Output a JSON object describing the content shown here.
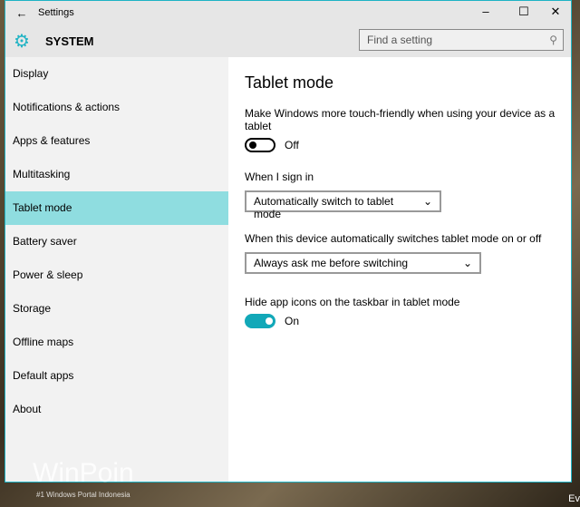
{
  "window": {
    "title": "Settings",
    "section": "SYSTEM"
  },
  "search": {
    "placeholder": "Find a setting"
  },
  "sidebar": {
    "items": [
      {
        "label": "Display"
      },
      {
        "label": "Notifications & actions"
      },
      {
        "label": "Apps & features"
      },
      {
        "label": "Multitasking"
      },
      {
        "label": "Tablet mode",
        "selected": true
      },
      {
        "label": "Battery saver"
      },
      {
        "label": "Power & sleep"
      },
      {
        "label": "Storage"
      },
      {
        "label": "Offline maps"
      },
      {
        "label": "Default apps"
      },
      {
        "label": "About"
      }
    ]
  },
  "main": {
    "title": "Tablet mode",
    "touch_label": "Make Windows more touch-friendly when using your device as a tablet",
    "touch_state": "Off",
    "signin_label": "When I sign in",
    "signin_value": "Automatically switch to tablet mode",
    "switch_label": "When this device automatically switches tablet mode on or off",
    "switch_value": "Always ask me before switching",
    "hide_label": "Hide app icons on the taskbar in tablet mode",
    "hide_state": "On"
  },
  "watermark": {
    "brand": "WinPoin",
    "tagline": "#1 Windows Portal Indonesia"
  },
  "desktop": {
    "corner_text": "Ev"
  },
  "colors": {
    "accent": "#1fb3c4",
    "selected": "#8fdde0"
  }
}
